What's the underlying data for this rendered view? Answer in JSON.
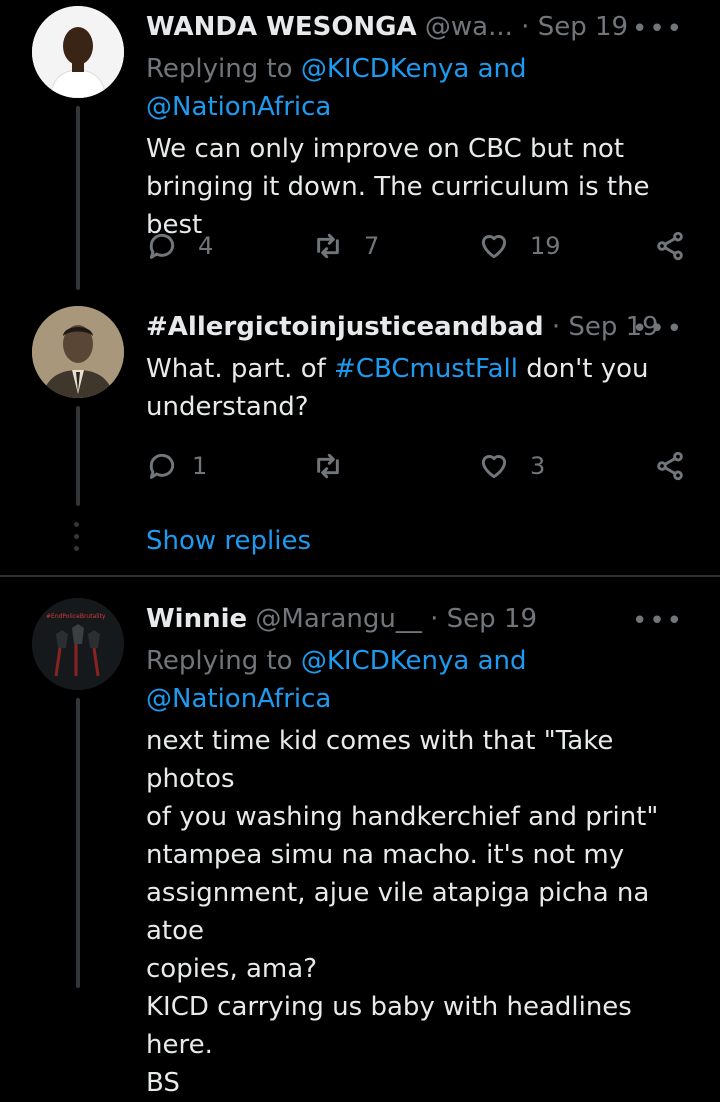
{
  "tweets": [
    {
      "name": "WANDA WESONGA",
      "handle": "@wa...",
      "sep": " · ",
      "date": "Sep 19",
      "replying_prefix": "Replying to ",
      "replying_user1": "@KICDKenya",
      "replying_and": " and",
      "replying_user2": "@NationAfrica",
      "text": "We can only improve on CBC but not\nbringing it down. The curriculum is the best",
      "replies": "4",
      "retweets": "7",
      "likes": "19"
    },
    {
      "name": "#Allergictoinjusticeandbad",
      "sep": " · ",
      "date": "Sep 19",
      "text_pre": "What. part. of ",
      "hashtag": "#CBCmustFall",
      "text_post": " don't you\nunderstand?",
      "replies": "1",
      "retweets": "",
      "likes": "3"
    },
    {
      "name": "Winnie",
      "handle": "@Marangu__",
      "sep": " · ",
      "date": "Sep 19",
      "replying_prefix": "Replying to ",
      "replying_user1": "@KICDKenya",
      "replying_and": " and",
      "replying_user2": "@NationAfrica",
      "text": "next time kid comes with that \"Take photos\nof you washing handkerchief and print\"\nntampea simu na macho. it's not my\nassignment, ajue vile atapiga picha na atoe\ncopies, ama?\nKICD carrying us baby with headlines here.\nBS",
      "avatar_text": "#EndPoliceBrutality"
    }
  ],
  "show_replies": "Show replies",
  "more_glyph": "•••",
  "icons": [
    "reply-icon",
    "retweet-icon",
    "like-icon",
    "share-icon",
    "more-icon"
  ],
  "colors": {
    "background": "#000000",
    "text": "#e7e9ea",
    "muted": "#71767b",
    "link": "#1d9bf0",
    "divider": "#2f3336"
  }
}
